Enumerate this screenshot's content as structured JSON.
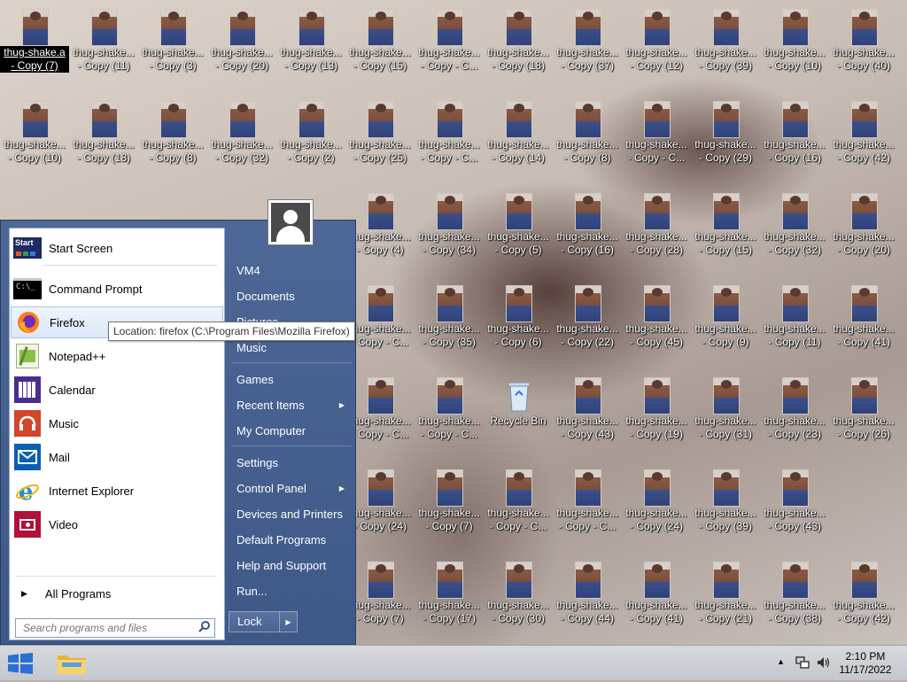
{
  "desktop": {
    "rows": [
      [
        "thug-shake.a - Copy (7)",
        "thug-shake... - Copy (11)",
        "thug-shake... - Copy (3)",
        "thug-shake... - Copy (20)",
        "thug-shake... - Copy (13)",
        "thug-shake... - Copy (15)",
        "thug-shake... - Copy - C...",
        "thug-shake... - Copy (18)",
        "thug-shake... - Copy (37)",
        "thug-shake... - Copy (12)",
        "thug-shake... - Copy (39)",
        "thug-shake... - Copy (10)",
        "thug-shake... - Copy (40)"
      ],
      [
        "thug-shake... - Copy (10)",
        "thug-shake... - Copy (18)",
        "thug-shake... - Copy (8)",
        "thug-shake... - Copy (32)",
        "thug-shake... - Copy (2)",
        "thug-shake... - Copy (25)",
        "thug-shake... - Copy - C...",
        "thug-shake... - Copy (14)",
        "thug-shake... - Copy (8)",
        "thug-shake... - Copy - C...",
        "thug-shake... - Copy (29)",
        "thug-shake... - Copy (16)",
        "thug-shake... - Copy (42)"
      ],
      [
        "thug-shake... - Copy (4)",
        "thug-shake... - Copy (34)",
        "thug-shake... - Copy (5)",
        "thug-shake... - Copy (16)",
        "thug-shake... - Copy (28)",
        "thug-shake... - Copy (15)",
        "thug-shake... - Copy (32)",
        "thug-shake... - Copy (20)"
      ],
      [
        "thug-shake... - Copy - C...",
        "thug-shake... - Copy (35)",
        "thug-shake... - Copy (6)",
        "thug-shake... - Copy (22)",
        "thug-shake... - Copy (45)",
        "thug-shake... - Copy (9)",
        "thug-shake... - Copy (11)",
        "thug-shake... - Copy (41)"
      ],
      [
        "thug-shake... - Copy - C...",
        "thug-shake... - Copy - C...",
        "Recycle Bin",
        "thug-shake... - Copy (43)",
        "thug-shake... - Copy (19)",
        "thug-shake... - Copy (31)",
        "thug-shake... - Copy (23)",
        "thug-shake... - Copy (26)"
      ],
      [
        "thug-shake... - Copy (24)",
        "thug-shake... - Copy (7)",
        "thug-shake... - Copy - C...",
        "thug-shake... - Copy - C...",
        "thug-shake... - Copy (24)",
        "thug-shake... - Copy (39)",
        "thug-shake... - Copy (43)"
      ],
      [
        "thug-shake... - Copy (7)",
        "thug-shake... - Copy (17)",
        "thug-shake... - Copy (30)",
        "thug-shake... - Copy (44)",
        "thug-shake... - Copy (41)",
        "thug-shake... - Copy (21)",
        "thug-shake... - Copy (38)",
        "thug-shake... - Copy (42)"
      ]
    ]
  },
  "start_menu": {
    "programs": [
      {
        "label": "Start Screen",
        "icon": "start-screen-icon"
      },
      {
        "label": "Command Prompt",
        "icon": "command-prompt-icon"
      },
      {
        "label": "Firefox",
        "icon": "firefox-icon"
      },
      {
        "label": "Notepad++",
        "icon": "notepad-plus-plus-icon"
      },
      {
        "label": "Calendar",
        "icon": "calendar-icon"
      },
      {
        "label": "Music",
        "icon": "music-icon"
      },
      {
        "label": "Mail",
        "icon": "mail-icon"
      },
      {
        "label": "Internet Explorer",
        "icon": "internet-explorer-icon"
      },
      {
        "label": "Video",
        "icon": "video-icon"
      }
    ],
    "start_icon_text": "Start",
    "all_programs": "All Programs",
    "search_placeholder": "Search programs and files",
    "right": {
      "user": "VM4",
      "documents": "Documents",
      "pictures": "Pictures",
      "music": "Music",
      "games": "Games",
      "recent_items": "Recent Items",
      "my_computer": "My Computer",
      "settings": "Settings",
      "control_panel": "Control Panel",
      "devices_printers": "Devices and Printers",
      "default_programs": "Default Programs",
      "help_support": "Help and Support",
      "run": "Run..."
    },
    "lock": "Lock",
    "tooltip": "Location: firefox (C:\\Program Files\\Mozilla Firefox)"
  },
  "taskbar": {
    "time": "2:10 PM",
    "date": "11/17/2022"
  },
  "colors": {
    "start_menu_bg": "#4d6796",
    "hover": "#dbe8f8"
  }
}
